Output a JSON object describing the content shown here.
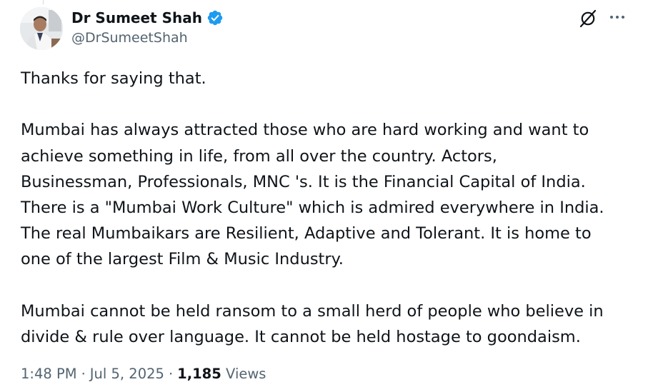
{
  "author": {
    "display_name": "Dr Sumeet Shah",
    "handle": "@DrSumeetShah",
    "verified": true,
    "verified_color": "#1d9bf0"
  },
  "actions": {
    "grok_icon": "grok-icon",
    "more_icon": "more-horizontal-icon"
  },
  "tweet": {
    "paragraphs": [
      {
        "lines": [
          "Thanks for saying that."
        ]
      },
      {
        "lines": [
          "Mumbai has always attracted those who are hard working and want to",
          "achieve something in life, from all over the country. Actors,",
          "Businessman, Professionals, MNC 's. It is the Financial Capital of India.",
          "There is a \"Mumbai Work Culture\" which is admired everywhere in India.",
          "The real Mumbaikars are Resilient, Adaptive and Tolerant. It is home to",
          "one of the largest Film & Music Industry."
        ]
      },
      {
        "lines": [
          "Mumbai cannot be held ransom to a small herd of people who believe in",
          "divide & rule over language. It cannot be held hostage to goondaism."
        ]
      }
    ]
  },
  "meta": {
    "time": "1:48 PM",
    "separator": "·",
    "date": "Jul 5, 2025",
    "views_count": "1,185",
    "views_label": "Views"
  },
  "colors": {
    "text": "#0f1419",
    "secondary": "#536471",
    "background": "#ffffff"
  }
}
